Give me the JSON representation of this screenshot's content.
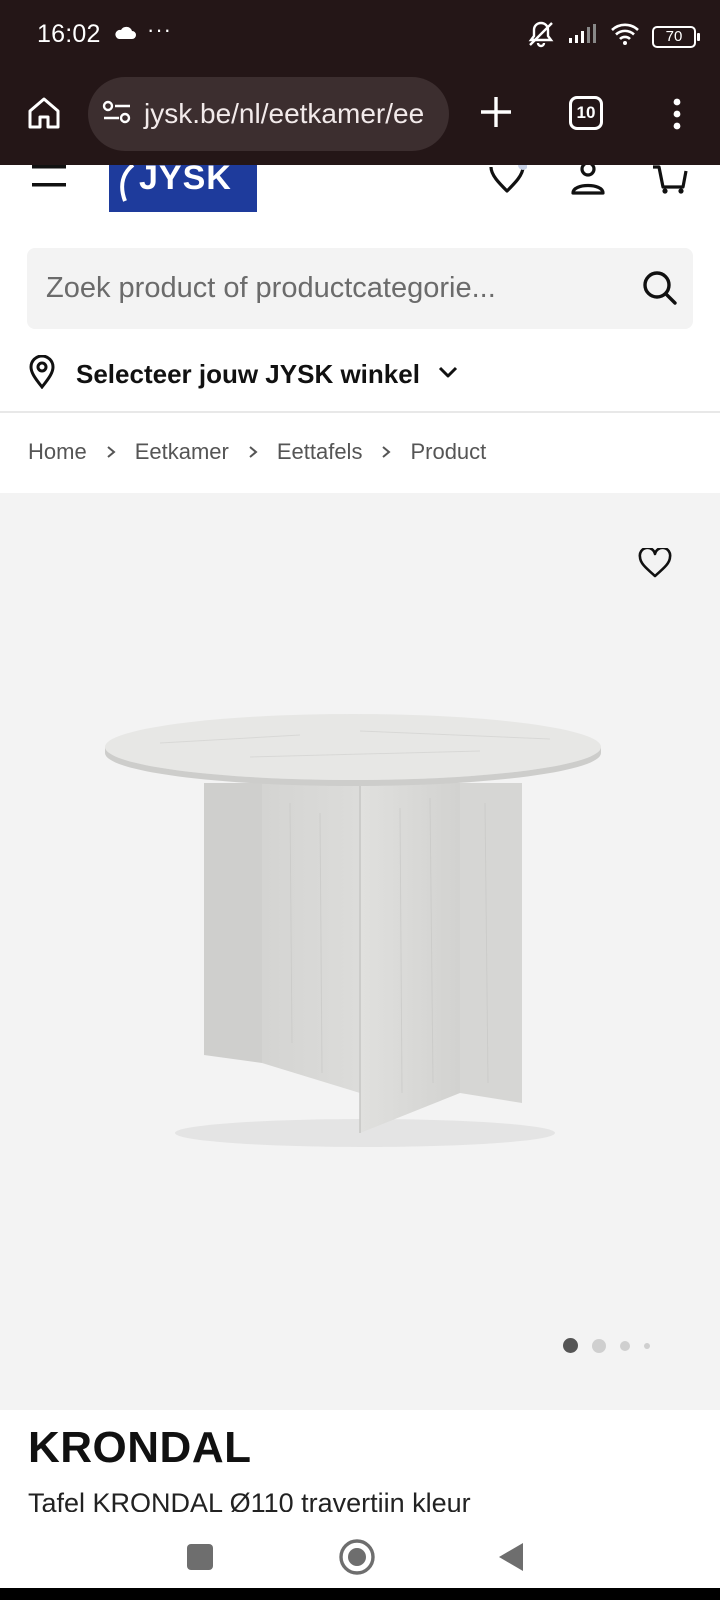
{
  "status_bar": {
    "time": "16:02",
    "dots": "···",
    "battery": "70",
    "icons": [
      "cloud-icon",
      "mute-icon",
      "signal-icon",
      "wifi-icon",
      "battery-icon"
    ]
  },
  "browser": {
    "url": "jysk.be/nl/eetkamer/ee",
    "tab_count": "10",
    "icons": [
      "home-icon",
      "site-settings-icon",
      "plus-icon",
      "more-vert-icon"
    ]
  },
  "header": {
    "logo_text": "JYSK",
    "icons": [
      "hamburger-icon",
      "heart-icon",
      "user-icon",
      "cart-icon"
    ],
    "brand_color": "#1e3b9c"
  },
  "search": {
    "placeholder": "Zoek product of productcategorie..."
  },
  "store": {
    "label": "Selecteer jouw JYSK winkel"
  },
  "breadcrumb": [
    "Home",
    "Eetkamer",
    "Eettafels",
    "Product"
  ],
  "gallery": {
    "image_count": 4,
    "active_index": 0,
    "image_alt": "Tafel KRONDAL"
  },
  "product": {
    "name": "KRONDAL",
    "description": "Tafel KRONDAL Ø110 travertijn kleur"
  }
}
